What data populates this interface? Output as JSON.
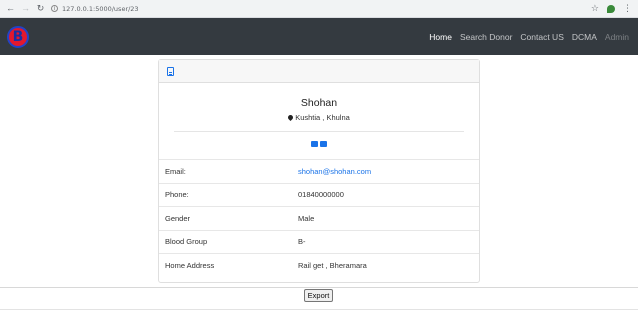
{
  "browser": {
    "url": "127.0.0.1:5000/user/23"
  },
  "navbar": {
    "logo_letter": "B",
    "items": [
      {
        "label": "Home",
        "state": "active"
      },
      {
        "label": "Search Donor",
        "state": "normal"
      },
      {
        "label": "Contact US",
        "state": "normal"
      },
      {
        "label": "DCMA",
        "state": "normal"
      },
      {
        "label": "Admin",
        "state": "muted"
      }
    ]
  },
  "profile": {
    "name": "Shohan",
    "location": "Kushtia , Khulna"
  },
  "details": [
    {
      "label": "Email:",
      "value": "shohan@shohan.com"
    },
    {
      "label": "Phone:",
      "value": "01840000000"
    },
    {
      "label": "Gender",
      "value": "Male"
    },
    {
      "label": "Blood Group",
      "value": "B-"
    },
    {
      "label": "Home Address",
      "value": "Rail get , Bheramara"
    }
  ],
  "export_label": "Export",
  "colors": {
    "navbar_bg": "#343a40",
    "link": "#1a73e8",
    "logo_red": "#e3182d",
    "logo_blue": "#2342c8"
  }
}
